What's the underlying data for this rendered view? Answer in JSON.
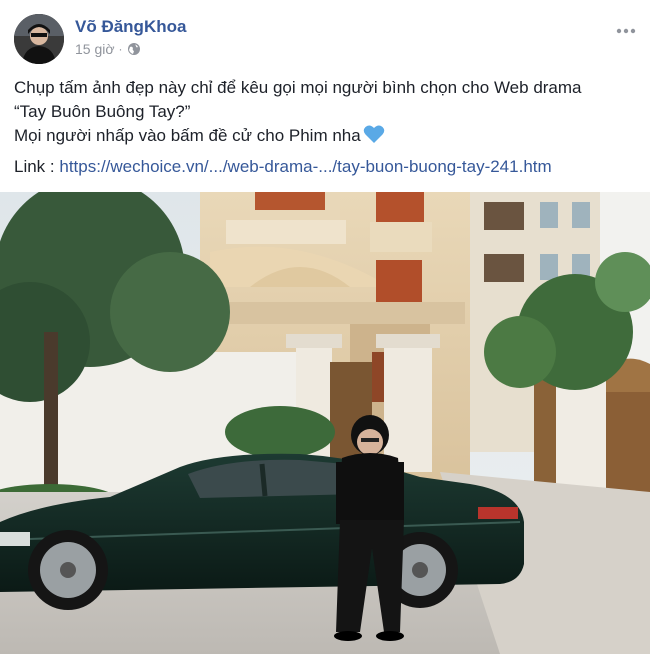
{
  "post": {
    "author": "Võ ĐăngKhoa",
    "time": "15 giờ",
    "separator": "·",
    "text_line1": "Chụp tấm ảnh đẹp này chỉ để kêu gọi mọi người bình chọn cho Web drama",
    "text_line2": "“Tay Buôn Buông Tay?”",
    "text_line3": "Mọi người nhấp vào bấm đề cử cho Phim nha",
    "link_label": "Link : ",
    "link_url": "https://wechoice.vn/.../web-drama-.../tay-buon-buong-tay-241.htm"
  },
  "icons": {
    "globe": "globe-icon",
    "more": "more-options-icon",
    "heart": "blue-heart-icon"
  },
  "colors": {
    "author": "#365899",
    "link": "#365899",
    "meta": "#90949c",
    "heart": "#5aa9e6"
  }
}
